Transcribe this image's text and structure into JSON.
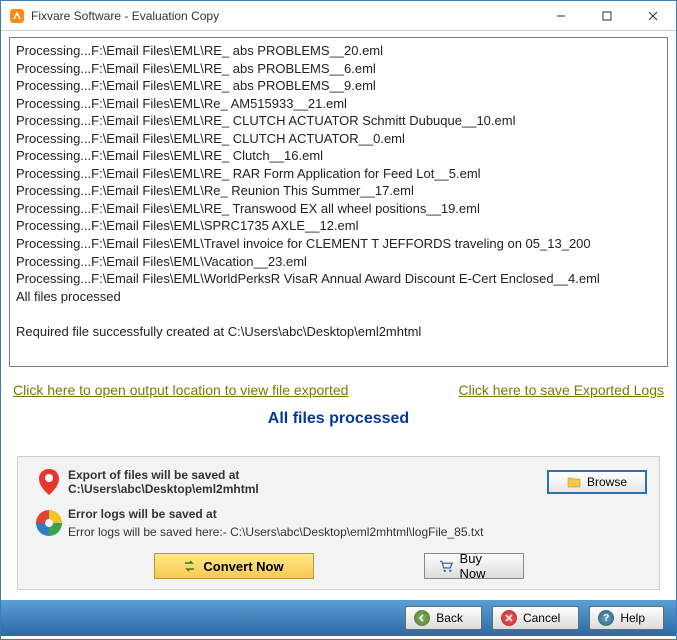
{
  "title": "Fixvare Software - Evaluation Copy",
  "log_lines": [
    "Processing...F:\\Email Files\\EML\\RE_ abs PROBLEMS__20.eml",
    "Processing...F:\\Email Files\\EML\\RE_ abs PROBLEMS__6.eml",
    "Processing...F:\\Email Files\\EML\\RE_ abs PROBLEMS__9.eml",
    "Processing...F:\\Email Files\\EML\\Re_ AM515933__21.eml",
    "Processing...F:\\Email Files\\EML\\RE_ CLUTCH ACTUATOR Schmitt Dubuque__10.eml",
    "Processing...F:\\Email Files\\EML\\RE_ CLUTCH ACTUATOR__0.eml",
    "Processing...F:\\Email Files\\EML\\RE_ Clutch__16.eml",
    "Processing...F:\\Email Files\\EML\\RE_ RAR Form Application for Feed Lot__5.eml",
    "Processing...F:\\Email Files\\EML\\Re_ Reunion This Summer__17.eml",
    "Processing...F:\\Email Files\\EML\\RE_ Transwood EX all wheel positions__19.eml",
    "Processing...F:\\Email Files\\EML\\SPRC1735 AXLE__12.eml",
    "Processing...F:\\Email Files\\EML\\Travel invoice for CLEMENT T JEFFORDS traveling on 05_13_200",
    "Processing...F:\\Email Files\\EML\\Vacation__23.eml",
    "Processing...F:\\Email Files\\EML\\WorldPerksR VisaR Annual Award Discount E-Cert Enclosed__4.eml",
    "All files processed",
    "",
    "Required file successfully created at C:\\Users\\abc\\Desktop\\eml2mhtml"
  ],
  "links": {
    "open_output": "Click here to open output location to view file exported",
    "save_logs": "Click here to save Exported Logs"
  },
  "status": "All files processed",
  "export": {
    "label": "Export of files will be saved at",
    "path": "C:\\Users\\abc\\Desktop\\eml2mhtml",
    "browse": "Browse"
  },
  "error": {
    "label": "Error logs will be saved at",
    "path": "  Error logs will be saved here:- C:\\Users\\abc\\Desktop\\eml2mhtml\\logFile_85.txt"
  },
  "buttons": {
    "convert": "Convert Now",
    "buy": "Buy Now",
    "back": "Back",
    "cancel": "Cancel",
    "help": "Help"
  }
}
